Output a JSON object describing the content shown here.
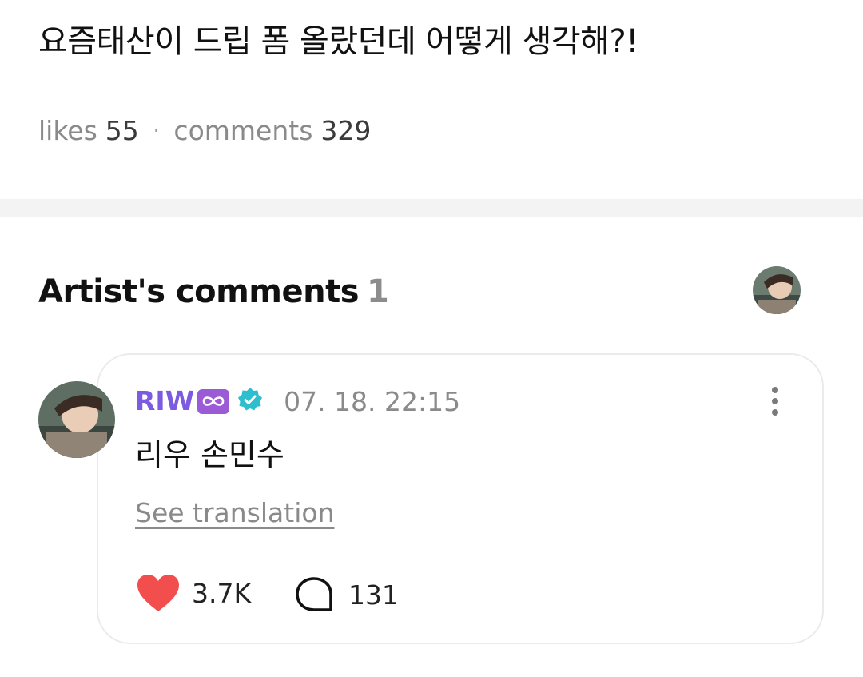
{
  "post": {
    "title": "요즘태산이  드립 폼 올랐던데 어떻게 생각해?!",
    "likes_label": "likes",
    "likes_count": "55",
    "separator": "·",
    "comments_label": "comments",
    "comments_count": "329"
  },
  "artist_comments": {
    "heading": "Artist's comments",
    "count": "1"
  },
  "comment": {
    "author": "RIW",
    "author_badge": "infinity-icon",
    "verified_icon": "verified-badge-icon",
    "timestamp": "07. 18. 22:15",
    "body": "리우 손민수",
    "see_translation": "See translation",
    "like_count": "3.7K",
    "reply_count": "131"
  },
  "colors": {
    "author_name": "#7c5be0",
    "badge_purple": "#9b5ad6",
    "verified_teal": "#2ebfcf",
    "heart_red": "#f24e4e",
    "muted_text": "#8a8a8a",
    "divider": "#f3f3f3"
  }
}
